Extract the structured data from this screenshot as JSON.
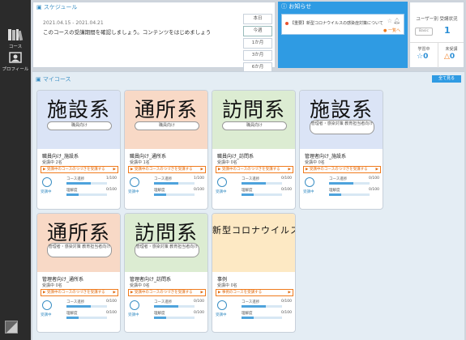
{
  "sidebar": {
    "items": [
      {
        "label": "コース",
        "icon": "books-icon"
      },
      {
        "label": "プロフィール",
        "icon": "profile-icon"
      }
    ]
  },
  "schedule": {
    "title": "スケジュール",
    "date": "2021.04.15 - 2021.04.21",
    "text": "このコースの受講期間を確認しましょう。コンテンツをはじめましょう",
    "tabs": [
      "本日",
      "今週",
      "1か月",
      "3か月",
      "6か月"
    ]
  },
  "notice": {
    "title": "お知らせ",
    "item_text": "【重要】新型コロナウイルスの感染症対策について",
    "more": "一覧へ"
  },
  "stats": {
    "title": "ユーザー別 受講状況",
    "badge": "Basic",
    "count_main": "1",
    "left_label": "学習中",
    "left_value": "0",
    "right_label": "未受講",
    "right_value": "0"
  },
  "mycourse": {
    "title": "マイコース",
    "see_all": "全て見る"
  },
  "cards": [
    {
      "title": "施設系",
      "pill": "職員向け",
      "bg": "#dbe4f6",
      "name": "職員向け_施設系",
      "ctr": "受講中 2名",
      "bar": "▶ 受講中のコースのつづきを受講する",
      "stat": "受講中",
      "prog1": "コース進捗",
      "prog2": "理解度",
      "val1": "1/100",
      "val2": "0/100"
    },
    {
      "title": "通所系",
      "pill": "職員向け",
      "bg": "#f8d9c6",
      "name": "職員向け_通所系",
      "ctr": "受講中 1名",
      "bar": "▶ 受講中のコースのつづきを受講する",
      "stat": "受講中",
      "prog1": "コース進捗",
      "prog2": "理解度",
      "val1": "1/100",
      "val2": "0/100"
    },
    {
      "title": "訪問系",
      "pill": "職員向け",
      "bg": "#dcecd2",
      "name": "職員向け_訪問系",
      "ctr": "受講中 0名",
      "bar": "▶ 受講中のコースのつづきを受講する",
      "stat": "受講中",
      "prog1": "コース進捗",
      "prog2": "理解度",
      "val1": "0/100",
      "val2": "0/100"
    },
    {
      "title": "施設系",
      "pill": "管理者・感染対策 教育担当者向け",
      "bg": "#dbe4f6",
      "name": "管理者向け_施設系",
      "ctr": "受講中 0名",
      "bar": "▶ 受講中のコースのつづきを受講する",
      "stat": "受講中",
      "prog1": "コース進捗",
      "prog2": "理解度",
      "val1": "0/100",
      "val2": "0/100"
    },
    {
      "title": "通所系",
      "pill": "管理者・感染対策 教育担当者向け",
      "bg": "#f8d9c6",
      "name": "管理者向け_通所系",
      "ctr": "受講中 0名",
      "bar": "▶ 受講中のコースのつづきを受講する",
      "stat": "受講中",
      "prog1": "コース進捗",
      "prog2": "理解度",
      "val1": "0/100",
      "val2": "0/100"
    },
    {
      "title": "訪問系",
      "pill": "管理者・感染対策 教育担当者向け",
      "bg": "#dcecd2",
      "name": "管理者向け_訪問系",
      "ctr": "受講中 0名",
      "bar": "▶ 受講中のコースのつづきを受講する",
      "stat": "受講中",
      "prog1": "コース進捗",
      "prog2": "理解度",
      "val1": "0/100",
      "val2": "0/100"
    },
    {
      "title": "新型コロナウイルス感染症の事例",
      "pill": "",
      "bg": "#fde9c4",
      "name": "事例",
      "ctr": "受講中 0名",
      "bar": "▶ 事例のコースを受講する",
      "stat": "受講中",
      "prog1": "コース進捗",
      "prog2": "理解度",
      "val1": "0/100",
      "val2": "0/100"
    }
  ]
}
